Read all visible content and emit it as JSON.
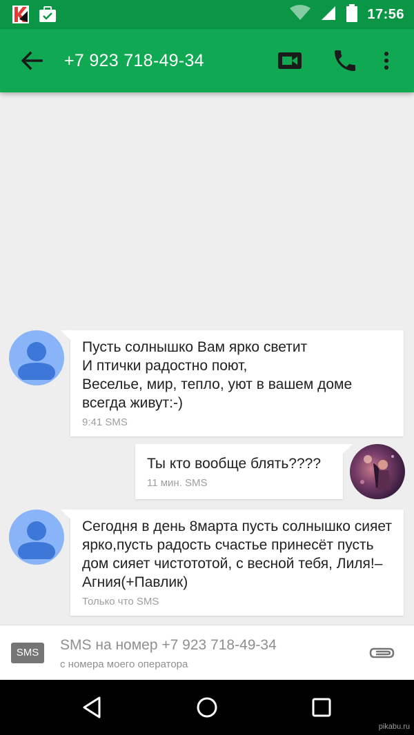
{
  "status_bar": {
    "time": "17:56",
    "icons": [
      "kaspersky-icon",
      "briefcase-check-icon",
      "wifi-icon",
      "signal-icon",
      "battery-icon"
    ]
  },
  "app_bar": {
    "title": "+7 923 718-49-34",
    "icons": [
      "back-arrow-icon",
      "video-call-icon",
      "phone-icon",
      "more-vert-icon"
    ]
  },
  "messages": [
    {
      "direction": "incoming",
      "text": "Пусть солнышко Вам ярко светит\nИ птички радостно поют,\nВеселье, мир, тепло, уют в вашем доме всегда живут:-)",
      "meta": "9:41 SMS"
    },
    {
      "direction": "outgoing",
      "text": "Ты кто вообще блять????",
      "meta": "11 мин. SMS"
    },
    {
      "direction": "incoming",
      "text": "Сегодня в день 8марта пусть солнышко сияет ярко,пусть радость счастье принесёт пусть дом сияет чистототой, с весной тебя, Лиля!– Агния(+Павлик)",
      "meta": "Только что SMS"
    }
  ],
  "compose": {
    "badge": "SMS",
    "placeholder": "SMS на номер +7 923 718-49-34",
    "subtext": "с номера моего оператора"
  },
  "watermark": "pikabu.ru",
  "colors": {
    "status_bar": "#0b9646",
    "app_bar": "#10a852",
    "avatar_default": "#8ab4f8",
    "avatar_silhouette": "#3d78d8"
  }
}
